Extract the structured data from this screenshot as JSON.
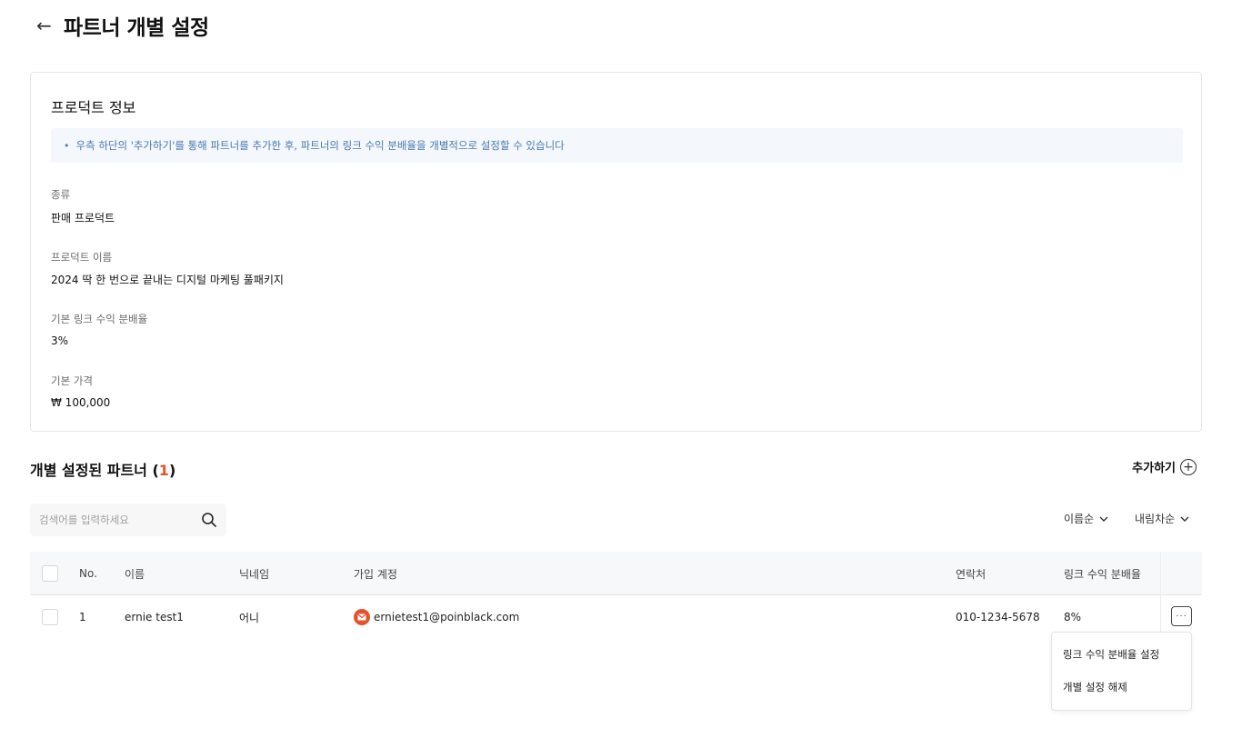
{
  "header": {
    "back_icon": "arrow-left-icon",
    "title": "파트너 개별 설정"
  },
  "product_info": {
    "title": "프로덕트 정보",
    "notice": "우측 하단의 '추가하기'를 통해 파트너를 추가한 후, 파트너의 링크 수익 분배율을 개별적으로 설정할 수 있습니다",
    "fields": [
      {
        "label": "종류",
        "value": "판매 프로덕트"
      },
      {
        "label": "프로덕트 이름",
        "value": "2024 딱 한 번으로 끝내는 디지털 마케팅 풀패키지"
      },
      {
        "label": "기본 링크 수익 분배율",
        "value": "3%"
      },
      {
        "label": "기본 가격",
        "value": "₩ 100,000"
      }
    ]
  },
  "partners": {
    "title": "개별 설정된 파트너 (",
    "count": "1",
    "title_close": ")",
    "add_label": "추가하기",
    "search_placeholder": "검색어를 입력하세요",
    "sort_by": "이름순",
    "sort_order": "내림차순",
    "columns": [
      "No.",
      "이름",
      "닉네임",
      "가입 계정",
      "연락처",
      "링크 수익 분배율"
    ],
    "rows": [
      {
        "no": "1",
        "name": "ernie test1",
        "nickname": "어니",
        "account": "ernietest1@poinblack.com",
        "contact": "010-1234-5678",
        "rate": "8%"
      }
    ],
    "more_label": "···"
  },
  "context_menu": {
    "items": [
      "링크 수익 분배율 설정",
      "개별 설정 해제"
    ]
  },
  "colors": {
    "accent": "#e5532d",
    "notice_text": "#4a7ab0",
    "notice_bg": "#f4f7fb"
  }
}
